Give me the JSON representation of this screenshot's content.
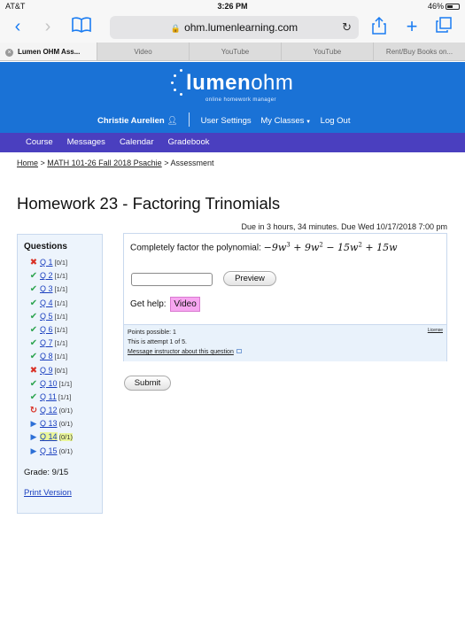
{
  "status": {
    "carrier": "AT&T",
    "time": "3:26 PM",
    "battery": "46%"
  },
  "browser": {
    "url": "ohm.lumenlearning.com",
    "tabs": [
      {
        "label": "Lumen OHM Ass..."
      },
      {
        "label": "Video"
      },
      {
        "label": "YouTube"
      },
      {
        "label": "YouTube"
      },
      {
        "label": "Rent/Buy Books on..."
      }
    ]
  },
  "header": {
    "logo_text_a": "lumen",
    "logo_text_b": "ohm",
    "tagline": "online homework manager",
    "user_name": "Christie Aurelien",
    "links": [
      "User Settings",
      "My Classes",
      "Log Out"
    ]
  },
  "nav": [
    "Course",
    "Messages",
    "Calendar",
    "Gradebook"
  ],
  "breadcrumb": {
    "home": "Home",
    "course": "MATH 101-26 Fall 2018 Psachie",
    "current": "Assessment"
  },
  "title": "Homework 23 - Factoring Trinomials",
  "due": "Due in 3 hours, 34 minutes. Due Wed 10/17/2018 7:00 pm",
  "sidebar": {
    "heading": "Questions",
    "questions": [
      {
        "label": "Q 1",
        "score": "[0/1]",
        "status": "incorrect",
        "icon": "x-icon"
      },
      {
        "label": "Q 2",
        "score": "[1/1]",
        "status": "correct",
        "icon": "check-icon"
      },
      {
        "label": "Q 3",
        "score": "[1/1]",
        "status": "correct",
        "icon": "check-icon"
      },
      {
        "label": "Q 4",
        "score": "[1/1]",
        "status": "correct",
        "icon": "check-icon"
      },
      {
        "label": "Q 5",
        "score": "[1/1]",
        "status": "correct",
        "icon": "check-icon"
      },
      {
        "label": "Q 6",
        "score": "[1/1]",
        "status": "correct",
        "icon": "check-icon"
      },
      {
        "label": "Q 7",
        "score": "[1/1]",
        "status": "correct",
        "icon": "check-icon"
      },
      {
        "label": "Q 8",
        "score": "[1/1]",
        "status": "correct",
        "icon": "check-icon"
      },
      {
        "label": "Q 9",
        "score": "[0/1]",
        "status": "incorrect",
        "icon": "x-icon"
      },
      {
        "label": "Q 10",
        "score": "[1/1]",
        "status": "correct",
        "icon": "check-icon"
      },
      {
        "label": "Q 11",
        "score": "[1/1]",
        "status": "correct",
        "icon": "check-icon"
      },
      {
        "label": "Q 12",
        "score": "(0/1)",
        "status": "retry",
        "icon": "retry-icon"
      },
      {
        "label": "Q 13",
        "score": "(0/1)",
        "status": "unattempted",
        "icon": "play-icon"
      },
      {
        "label": "Q 14",
        "score": "(0/1)",
        "status": "current",
        "icon": "play-icon"
      },
      {
        "label": "Q 15",
        "score": "(0/1)",
        "status": "unattempted",
        "icon": "play-icon"
      }
    ],
    "grade": "Grade: 9/15",
    "print": "Print Version"
  },
  "question": {
    "prompt": "Completely factor the polynomial:",
    "poly_parts": [
      "−9w",
      "3",
      " + 9w",
      "2",
      " − 15w",
      "2",
      " + 15w"
    ],
    "answer_value": "",
    "preview_label": "Preview",
    "get_help": "Get help:",
    "video_label": "Video",
    "points": "Points possible: 1",
    "attempt": "This is attempt 1 of 5.",
    "message": "Message instructor about this question",
    "license": "License"
  },
  "submit_label": "Submit",
  "colors": {
    "header_blue": "#1a72d6",
    "nav_purple": "#4a3fbf",
    "correct": "#2ea44f",
    "incorrect": "#d93025",
    "link": "#1a3fbf",
    "video_highlight": "#f7a6f0",
    "current_highlight": "#e9f59a"
  }
}
